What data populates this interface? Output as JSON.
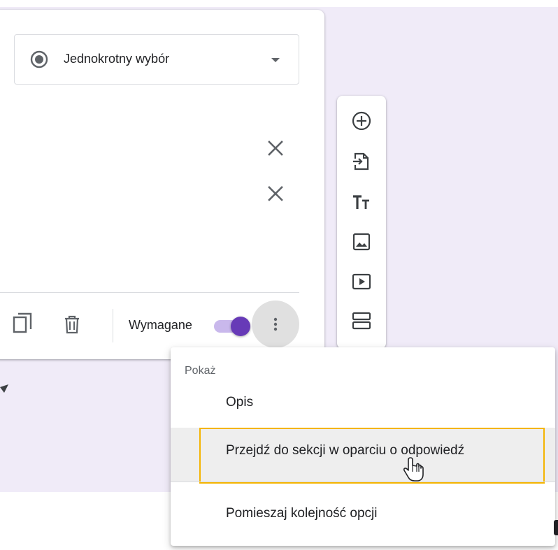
{
  "question": {
    "type_label": "Jednokrotny wybór",
    "required_label": "Wymagane",
    "required_on": true
  },
  "menu": {
    "header": "Pokaż",
    "items": [
      {
        "label": "Opis"
      },
      {
        "label": "Przejdź do sekcji w oparciu o odpowiedź"
      },
      {
        "label": "Pomieszaj kolejność opcji"
      }
    ]
  },
  "icons": {
    "type_icon": "radio-button-checked-icon",
    "remove": "close-icon",
    "duplicate": "copy-icon",
    "delete": "trash-icon",
    "more": "more-vert-icon",
    "toolbar": [
      "add-circle-icon",
      "import-icon",
      "title-icon",
      "image-icon",
      "video-icon",
      "section-icon"
    ]
  },
  "colors": {
    "accent": "#673ab7",
    "background": "#f0ebf8",
    "highlight": "#f4b400"
  }
}
